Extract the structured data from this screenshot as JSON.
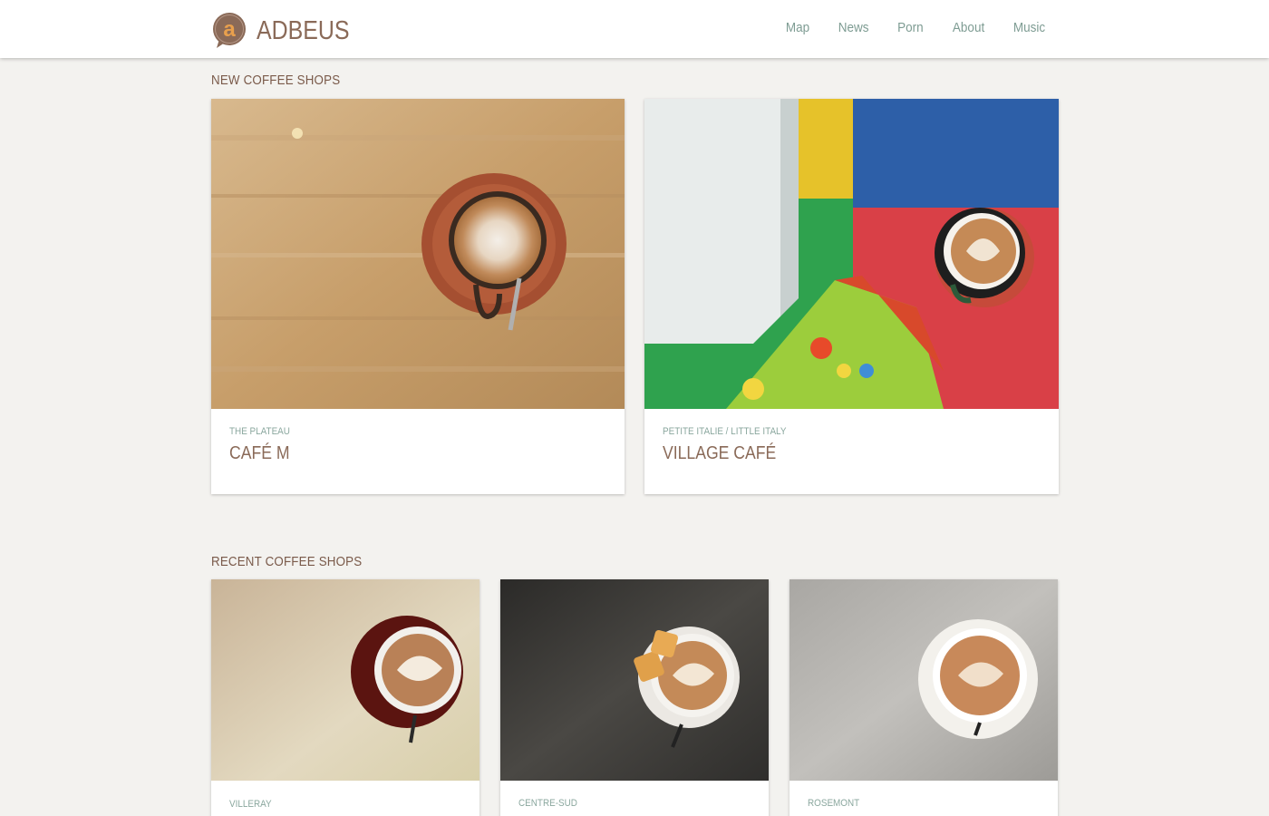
{
  "brand": {
    "name": "ADBEUS",
    "logo_letter": "a",
    "color": "#8a6a58",
    "accent": "#e8a04d"
  },
  "nav": {
    "items": [
      "Map",
      "News",
      "Porn",
      "About",
      "Music"
    ],
    "color": "#7e9c93"
  },
  "sections": {
    "new": {
      "title": "NEW COFFEE SHOPS",
      "cards": [
        {
          "neighbourhood": "THE PLATEAU",
          "name": "CAFÉ M",
          "image": "latte-on-wood-table-photo"
        },
        {
          "neighbourhood": "PETITE ITALIE / LITTLE ITALY",
          "name": "VILLAGE CAFÉ",
          "image": "latte-on-colorful-foam-mat-photo"
        }
      ]
    },
    "recent": {
      "title": "RECENT COFFEE SHOPS",
      "cards": [
        {
          "neighbourhood": "VILLERAY",
          "image": "latte-red-saucer-photo"
        },
        {
          "neighbourhood": "CENTRE-SUD",
          "image": "latte-with-cookie-photo"
        },
        {
          "neighbourhood": "ROSEMONT",
          "image": "latte-grey-table-photo"
        }
      ]
    }
  }
}
